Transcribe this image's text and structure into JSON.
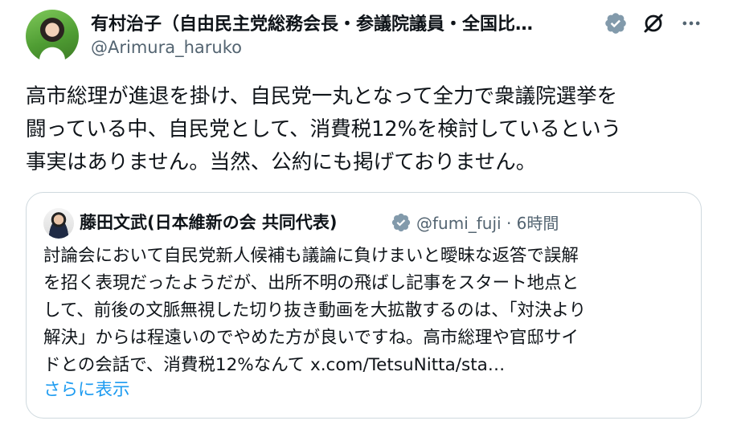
{
  "post": {
    "author_name": "有村治子（自由民主党総務会長・参議院議員・全国比…",
    "author_handle": "@Arimura_haruko",
    "body": "高市総理が進退を掛け、自民党一丸となって全力で衆議院選挙を\n闘っている中、自民党として、消費税12%を検討しているという\n事実はありません。当然、公約にも掲げておりません。"
  },
  "quote": {
    "author_name": "藤田文武(日本維新の会 共同代表)",
    "author_handle": "@fumi_fuji",
    "separator": "·",
    "time": "6時間",
    "body": "討論会において自民党新人候補も議論に負けまいと曖昧な返答で誤解\nを招く表現だったようだが、出所不明の飛ばし記事をスタート地点と\nして、前後の文脈無視した切り抜き動画を大拡散するのは、「対決より\n解決」からは程遠いのでやめた方が良いですね。高市総理や官邸サイ\nドとの会話で、消費税12%なんて x.com/TetsuNitta/sta…",
    "show_more": "さらに表示"
  },
  "colors": {
    "text": "#0f1419",
    "secondary": "#536471",
    "link": "#1d9bf0",
    "verified_gray": "#829aab",
    "border": "#cfd9de"
  },
  "icons": [
    "verified-badge-icon",
    "grok-icon",
    "more-icon"
  ]
}
